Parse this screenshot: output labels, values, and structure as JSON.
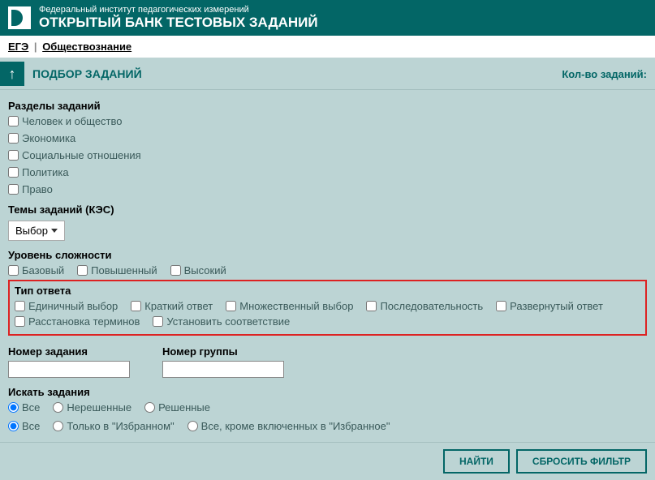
{
  "header": {
    "subtitle": "Федеральный институт педагогических измерений",
    "title": "ОТКРЫТЫЙ БАНК ТЕСТОВЫХ ЗАДАНИЙ"
  },
  "breadcrumb": {
    "item1": "ЕГЭ",
    "item2": "Обществознание"
  },
  "page_title": "ПОДБОР ЗАДАНИЙ",
  "count_label": "Кол-во заданий:",
  "sections": {
    "razdely_label": "Разделы заданий",
    "razdely": [
      "Человек и общество",
      "Экономика",
      "Социальные отношения",
      "Политика",
      "Право"
    ],
    "temy_label": "Темы заданий (КЭС)",
    "temy_select": "Выбор",
    "uroven_label": "Уровень сложности",
    "uroven": [
      "Базовый",
      "Повышенный",
      "Высокий"
    ],
    "tip_label": "Тип ответа",
    "tip": [
      "Единичный выбор",
      "Краткий ответ",
      "Множественный выбор",
      "Последовательность",
      "Развернутый ответ",
      "Расстановка терминов",
      "Установить соответствие"
    ],
    "nomer_zad_label": "Номер задания",
    "nomer_grp_label": "Номер группы",
    "iskat_label": "Искать задания",
    "iskat1": [
      "Все",
      "Нерешенные",
      "Решенные"
    ],
    "iskat2": [
      "Все",
      "Только в \"Избранном\"",
      "Все, кроме включенных в \"Избранное\""
    ]
  },
  "buttons": {
    "find": "НАЙТИ",
    "reset": "СБРОСИТЬ ФИЛЬТР"
  }
}
